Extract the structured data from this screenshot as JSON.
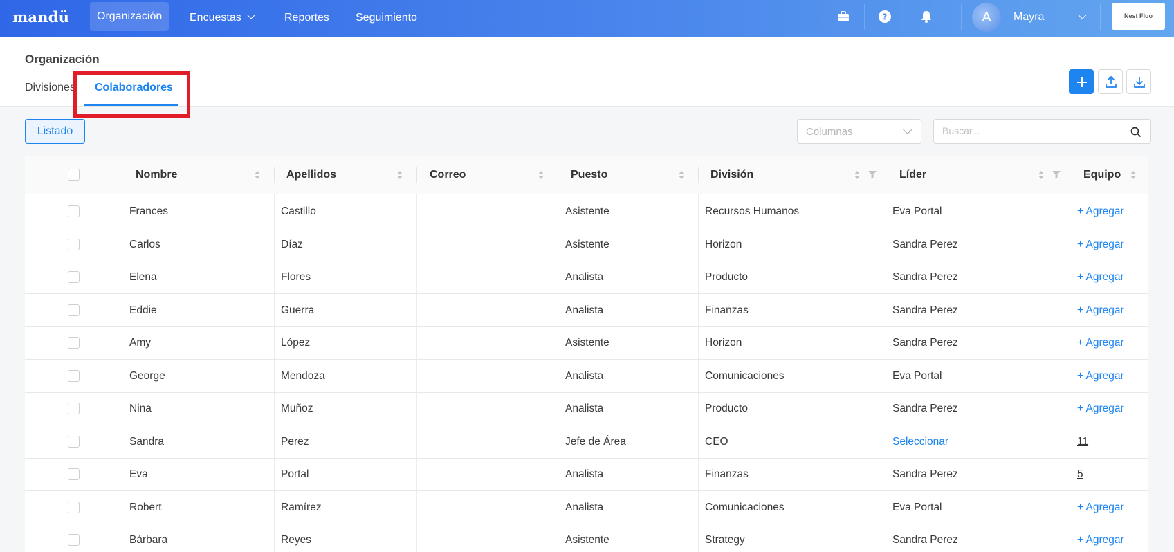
{
  "app": {
    "logo": "mandü",
    "org_logo_text": "Nest Fluo"
  },
  "nav": {
    "items": [
      {
        "label": "Organización",
        "active": true
      },
      {
        "label": "Encuestas",
        "has_dropdown": true
      },
      {
        "label": "Reportes"
      },
      {
        "label": "Seguimiento"
      }
    ],
    "icons": [
      "briefcase-icon",
      "help-icon",
      "bell-icon"
    ]
  },
  "user": {
    "avatar_initial": "A",
    "name": "Mayra"
  },
  "page": {
    "title": "Organización",
    "tabs": [
      {
        "label": "Divisiones",
        "active": false
      },
      {
        "label": "Colaboradores",
        "active": true
      }
    ]
  },
  "toolbar": {
    "view_label": "Listado",
    "columns_placeholder": "Columnas",
    "search_placeholder": "Buscar..."
  },
  "table": {
    "headers": {
      "nombre": "Nombre",
      "apellidos": "Apellidos",
      "correo": "Correo",
      "puesto": "Puesto",
      "division": "División",
      "lider": "Líder",
      "equipo": "Equipo"
    },
    "rows": [
      {
        "nombre": "Frances",
        "apellidos": "Castillo",
        "correo": "",
        "puesto": "Asistente",
        "division": "Recursos Humanos",
        "lider": "Eva Portal",
        "lider_is_link": false,
        "equipo": "+ Agregar",
        "equipo_type": "link"
      },
      {
        "nombre": "Carlos",
        "apellidos": "Díaz",
        "correo": "",
        "puesto": "Asistente",
        "division": "Horizon",
        "lider": "Sandra Perez",
        "lider_is_link": false,
        "equipo": "+ Agregar",
        "equipo_type": "link"
      },
      {
        "nombre": "Elena",
        "apellidos": "Flores",
        "correo": "",
        "puesto": "Analista",
        "division": "Producto",
        "lider": "Sandra Perez",
        "lider_is_link": false,
        "equipo": "+ Agregar",
        "equipo_type": "link"
      },
      {
        "nombre": "Eddie",
        "apellidos": "Guerra",
        "correo": "",
        "puesto": "Analista",
        "division": "Finanzas",
        "lider": "Sandra Perez",
        "lider_is_link": false,
        "equipo": "+ Agregar",
        "equipo_type": "link"
      },
      {
        "nombre": "Amy",
        "apellidos": "López",
        "correo": "",
        "puesto": "Asistente",
        "division": "Horizon",
        "lider": "Sandra Perez",
        "lider_is_link": false,
        "equipo": "+ Agregar",
        "equipo_type": "link"
      },
      {
        "nombre": "George",
        "apellidos": "Mendoza",
        "correo": "",
        "puesto": "Analista",
        "division": "Comunicaciones",
        "lider": "Eva Portal",
        "lider_is_link": false,
        "equipo": "+ Agregar",
        "equipo_type": "link"
      },
      {
        "nombre": "Nina",
        "apellidos": "Muñoz",
        "correo": "",
        "puesto": "Analista",
        "division": "Producto",
        "lider": "Sandra Perez",
        "lider_is_link": false,
        "equipo": "+ Agregar",
        "equipo_type": "link"
      },
      {
        "nombre": "Sandra",
        "apellidos": "Perez",
        "correo": "",
        "puesto": "Jefe de Área",
        "division": "CEO",
        "lider": "Seleccionar",
        "lider_is_link": true,
        "equipo": "11",
        "equipo_type": "count"
      },
      {
        "nombre": "Eva",
        "apellidos": "Portal",
        "correo": "",
        "puesto": "Analista",
        "division": "Finanzas",
        "lider": "Sandra Perez",
        "lider_is_link": false,
        "equipo": "5",
        "equipo_type": "count"
      },
      {
        "nombre": "Robert",
        "apellidos": "Ramírez",
        "correo": "",
        "puesto": "Analista",
        "division": "Comunicaciones",
        "lider": "Eva Portal",
        "lider_is_link": false,
        "equipo": "+ Agregar",
        "equipo_type": "link"
      },
      {
        "nombre": "Bárbara",
        "apellidos": "Reyes",
        "correo": "",
        "puesto": "Asistente",
        "division": "Strategy",
        "lider": "Sandra Perez",
        "lider_is_link": false,
        "equipo": "+ Agregar",
        "equipo_type": "link"
      }
    ]
  },
  "colors": {
    "accent": "#1d84f0",
    "highlight": "#e11d2a",
    "nav_start": "#2f67e8",
    "nav_end": "#63a6ef"
  }
}
